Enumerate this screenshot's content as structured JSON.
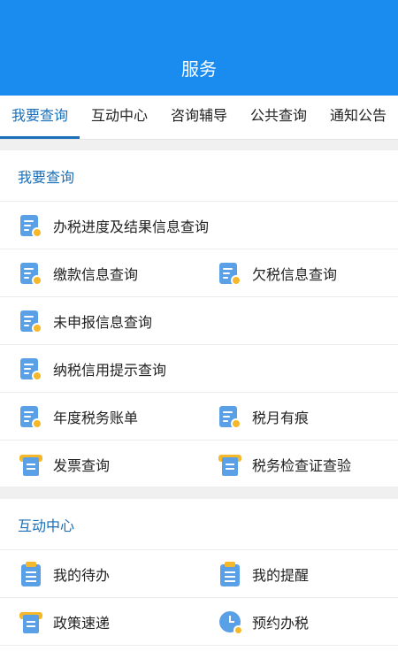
{
  "header": {
    "title": "服务",
    "bg": "#1a8cf0"
  },
  "tabs": [
    {
      "label": "我要查询",
      "active": true
    },
    {
      "label": "互动中心"
    },
    {
      "label": "咨询辅导"
    },
    {
      "label": "公共查询"
    },
    {
      "label": "通知公告"
    }
  ],
  "query": {
    "title": "我要查询",
    "items": {
      "progress": {
        "label": "办税进度及结果信息查询",
        "icon": "doc-search-icon"
      },
      "payment": {
        "label": "缴款信息查询",
        "icon": "doc-search-icon"
      },
      "arrears": {
        "label": "欠税信息查询",
        "icon": "doc-search-icon"
      },
      "unfiled": {
        "label": "未申报信息查询",
        "icon": "doc-search-icon"
      },
      "credit": {
        "label": "纳税信用提示查询",
        "icon": "doc-search-icon"
      },
      "annual": {
        "label": "年度税务账单",
        "icon": "doc-search-icon"
      },
      "monthly": {
        "label": "税月有痕",
        "icon": "doc-search-icon"
      },
      "invoice": {
        "label": "发票查询",
        "icon": "invoice-icon"
      },
      "inspection": {
        "label": "税务检查证查验",
        "icon": "invoice-icon"
      }
    }
  },
  "interact": {
    "title": "互动中心",
    "items": {
      "todo": {
        "label": "我的待办",
        "icon": "clipboard-icon"
      },
      "reminder": {
        "label": "我的提醒",
        "icon": "clipboard-icon"
      },
      "policy": {
        "label": "政策速递",
        "icon": "invoice-icon"
      },
      "appointment": {
        "label": "预约办税",
        "icon": "clock-icon"
      }
    }
  },
  "colors": {
    "accent": "#1a6fb8",
    "icon_blue": "#5aa0e6",
    "icon_yellow": "#f5b82a"
  }
}
